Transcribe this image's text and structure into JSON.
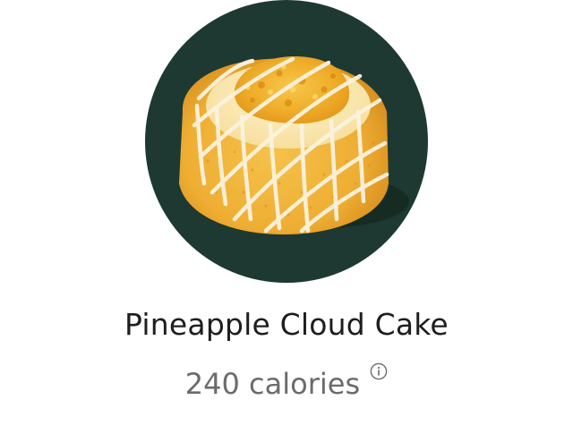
{
  "product": {
    "name": "Pineapple Cloud Cake",
    "calories": "240 calories",
    "image_icon": "pineapple-cloud-cake-image",
    "info_icon": "info-icon"
  },
  "colors": {
    "image_background": "#1e3932",
    "cake": "#f2b73a",
    "drizzle": "#fbf3df",
    "title_text": "#1e1e1e",
    "calories_text": "#6b6b6b"
  }
}
